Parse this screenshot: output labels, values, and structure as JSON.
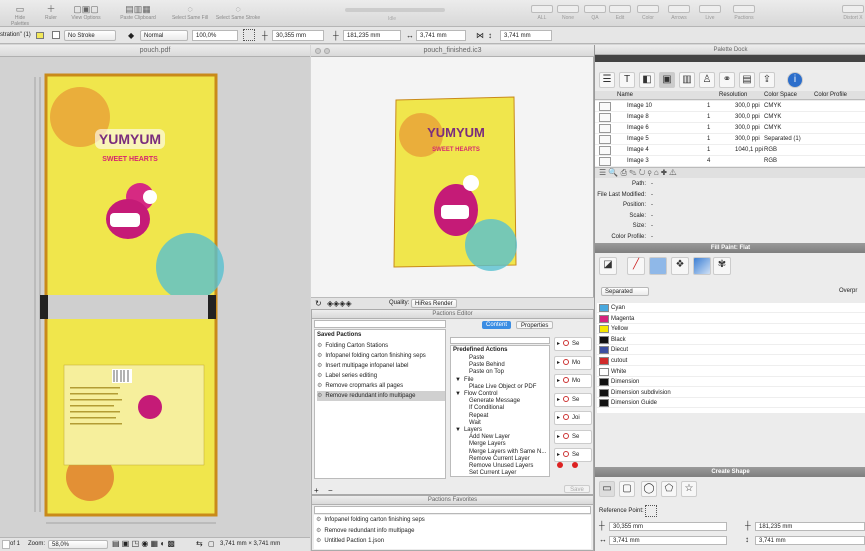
{
  "toolbar": {
    "left_items": [
      "Hide Palettes",
      "Ruler",
      "View Options",
      "Paste Clipboard",
      "Select Same Fill",
      "Select Same Stroke"
    ],
    "center_label": "Idle",
    "right_items": [
      "ALL",
      "None",
      "QA",
      "Edit",
      "Color",
      "Arrows",
      "Live",
      "Pactions"
    ],
    "far_right": "Distort X"
  },
  "ctrlbar": {
    "style_label": "stration\" (1)",
    "stroke": "No Stroke",
    "blend": "Normal",
    "opacity": "100,0%",
    "x": "30,355 mm",
    "y": "181,235 mm",
    "w": "3,741 mm",
    "h": "3,741 mm"
  },
  "left_doc": {
    "title": "pouch.pdf"
  },
  "mid_doc": {
    "title": "pouch_finished.ic3"
  },
  "mid_bar": {
    "quality_label": "Quality:",
    "quality_value": "HiRes Render"
  },
  "editor": {
    "title": "Pactions Editor",
    "saved_heading": "Saved Pactions",
    "saved_items": [
      "Folding Carton Stations",
      "Infopanel folding carton finishing seps",
      "Insert multipage infopanel label",
      "Label series editing",
      "Remove cropmarks all pages",
      "Remove redundant info multipage"
    ],
    "tab_content": "Content",
    "tab_properties": "Properties",
    "predefined_heading": "Predefined Actions",
    "predefined": [
      {
        "label": "Paste",
        "level": 2
      },
      {
        "label": "Paste Behind",
        "level": 2
      },
      {
        "label": "Paste on Top",
        "level": 2
      },
      {
        "label": "File",
        "level": 1
      },
      {
        "label": "Place Live Object or PDF",
        "level": 2
      },
      {
        "label": "Flow Control",
        "level": 1
      },
      {
        "label": "Generate Message",
        "level": 2
      },
      {
        "label": "If Conditional",
        "level": 2
      },
      {
        "label": "Repeat",
        "level": 2
      },
      {
        "label": "Wait",
        "level": 2
      },
      {
        "label": "Layers",
        "level": 1
      },
      {
        "label": "Add New Layer",
        "level": 2
      },
      {
        "label": "Merge Layers",
        "level": 2
      },
      {
        "label": "Merge Layers with Same N...",
        "level": 2
      },
      {
        "label": "Remove Current Layer",
        "level": 2
      },
      {
        "label": "Remove Unused Layers",
        "level": 2
      },
      {
        "label": "Set Current Layer",
        "level": 2
      }
    ],
    "steps": [
      "Se",
      "Mo",
      "Mo",
      "Se",
      "Joi",
      "Se",
      "Se"
    ],
    "save_label": "Save"
  },
  "favorites": {
    "title": "Pactions Favorites",
    "items": [
      "Infopanel folding carton finishing seps",
      "Remove redundant info multipage",
      "Untitled Paction 1.json"
    ]
  },
  "right": {
    "dock_title": "Palette Dock",
    "table_headers": [
      "Name",
      "Resolution",
      "Color Space",
      "Color Profile"
    ],
    "images": [
      {
        "name": "Image 10",
        "count": "1",
        "res": "300,0 ppi",
        "space": "CMYK"
      },
      {
        "name": "Image 8",
        "count": "1",
        "res": "300,0 ppi",
        "space": "CMYK"
      },
      {
        "name": "Image 6",
        "count": "1",
        "res": "300,0 ppi",
        "space": "CMYK"
      },
      {
        "name": "Image 5",
        "count": "1",
        "res": "300,0 ppi",
        "space": "Separated (1)"
      },
      {
        "name": "Image 4",
        "count": "1",
        "res": "1040,1 ppi",
        "space": "RGB"
      },
      {
        "name": "Image 3",
        "count": "4",
        "res": "",
        "space": "RGB"
      }
    ],
    "props": [
      "Path:",
      "File Last Modified:",
      "Position:",
      "Scale:",
      "Size:",
      "Color Profile:"
    ],
    "prop_value": "-",
    "fill_title": "Fill Paint: Flat",
    "separated_label": "Separated",
    "overprint_label": "Overpr",
    "separations": [
      {
        "name": "Cyan",
        "color": "#49a8de"
      },
      {
        "name": "Magenta",
        "color": "#d4237d"
      },
      {
        "name": "Yellow",
        "color": "#f5e600"
      },
      {
        "name": "Black",
        "color": "#111111"
      },
      {
        "name": "Diecut",
        "color": "#3c4fa0"
      },
      {
        "name": "cutout",
        "color": "#d02a2a"
      },
      {
        "name": "White",
        "color": "#ffffff"
      },
      {
        "name": "Dimension",
        "color": "#111111"
      },
      {
        "name": "Dimension subdivision",
        "color": "#111111"
      },
      {
        "name": "Dimension Guide",
        "color": "#111111"
      }
    ],
    "shape_title": "Create Shape",
    "ref_label": "Reference Point:",
    "x": "30,355 mm",
    "y": "181,235 mm",
    "w": "3,741 mm",
    "h": "3,741 mm"
  },
  "status": {
    "page": "of 1",
    "zoom_label": "Zoom:",
    "zoom": "58,0%",
    "size": "3,741 mm × 3,741 mm"
  },
  "artwork": {
    "brand": "YUMYUM",
    "tagline": "SWEET HEARTS"
  }
}
